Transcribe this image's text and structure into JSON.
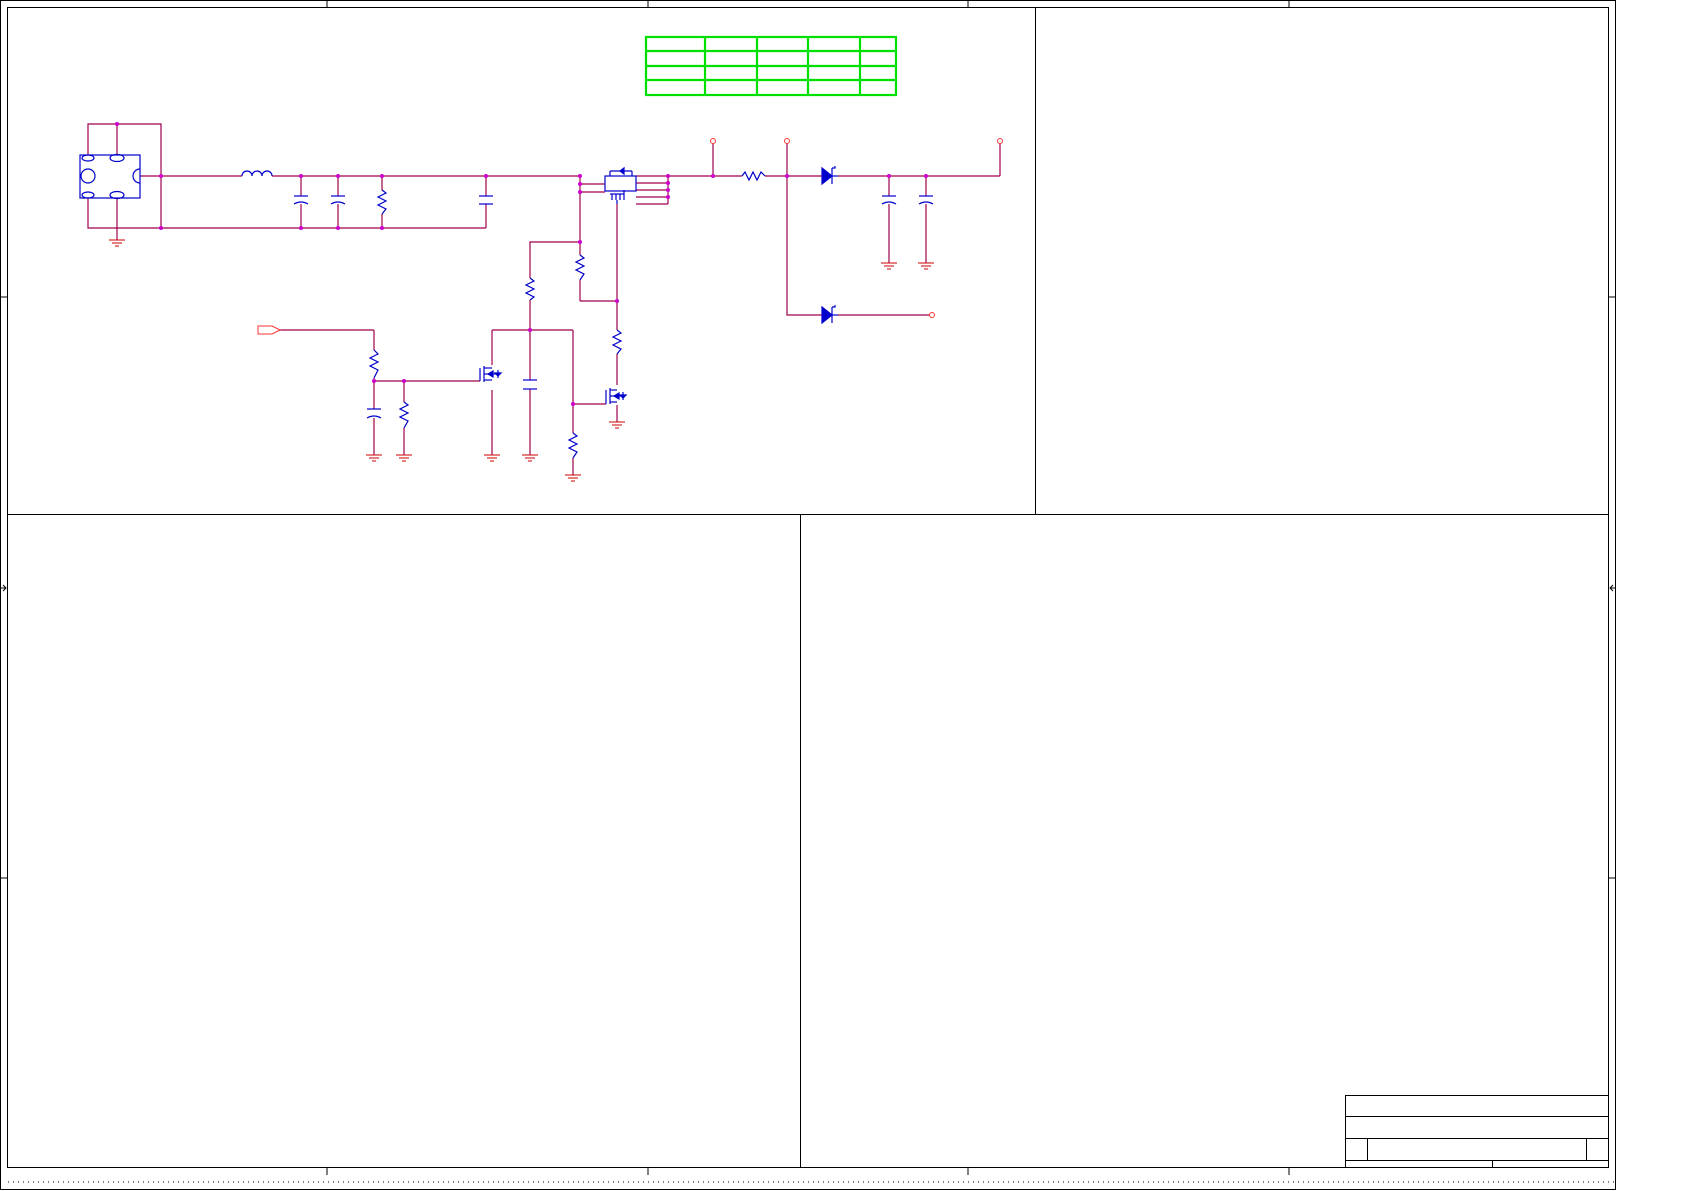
{
  "colors": {
    "frame": "#000000",
    "wire": "#a0004e",
    "symbol": "#0000cc",
    "junction": "#cc00cc",
    "port": "#ff3333",
    "table": "#00e000",
    "ground": "#cc0000",
    "background": "#ffffff"
  },
  "parts_table": {
    "rows": 4,
    "columns": 5
  },
  "title_block": {
    "fields": []
  },
  "schematic": {
    "off_sheet_port": "input-port-icon",
    "power_test_points": 3,
    "output_test_point": 1
  }
}
